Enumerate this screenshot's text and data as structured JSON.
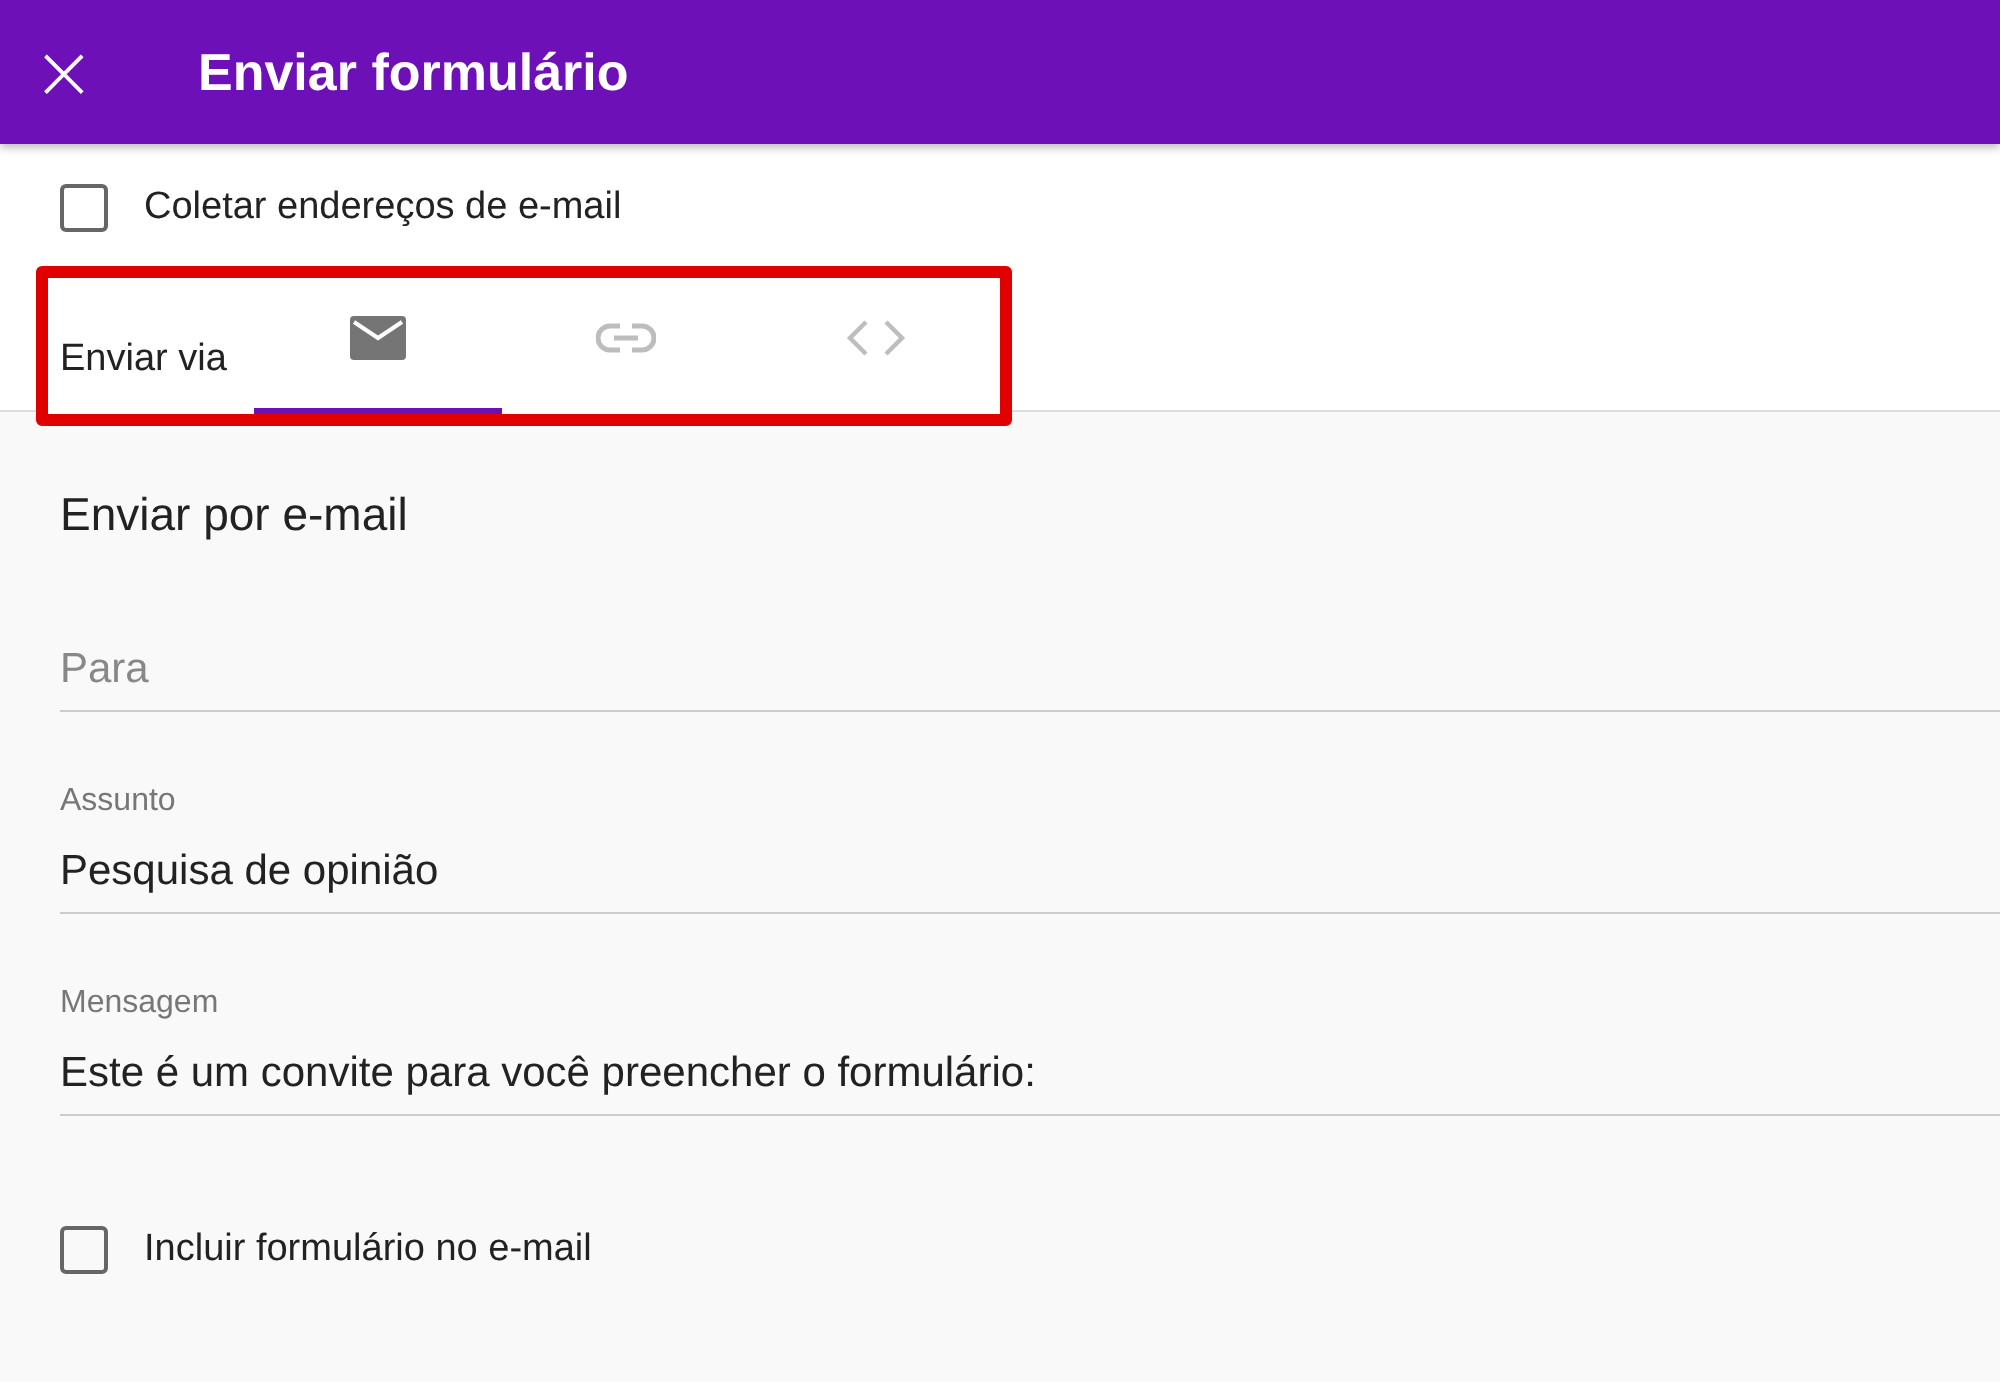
{
  "header": {
    "close_label": "×",
    "title": "Enviar formulário"
  },
  "collect_emails": {
    "label": "Coletar endereços de e-mail",
    "checked": false
  },
  "send_via": {
    "label": "Enviar via",
    "tabs": [
      {
        "kind": "email",
        "selected": true
      },
      {
        "kind": "link",
        "selected": false
      },
      {
        "kind": "embed",
        "selected": false
      }
    ]
  },
  "section_title": "Enviar por e-mail",
  "fields": [
    {
      "placeholder": "Para"
    },
    {
      "label": "Assunto",
      "value": "Pesquisa de opinião"
    },
    {
      "label": "Mensagem",
      "value": "Este é um convite para você preencher o formulário:"
    }
  ],
  "include_form": {
    "label": "Incluir formulário no e-mail",
    "checked": false
  }
}
